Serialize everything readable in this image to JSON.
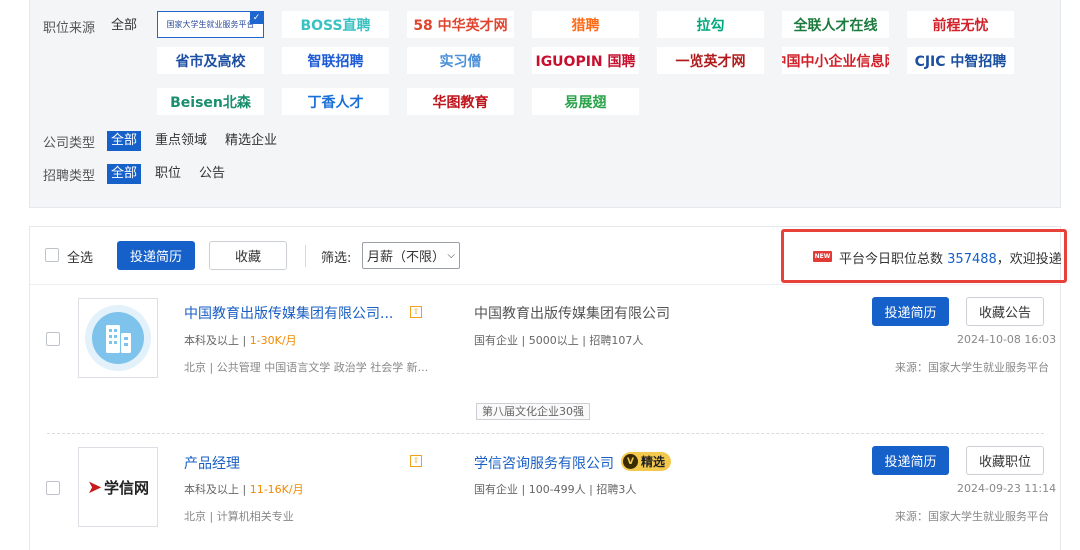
{
  "filters": {
    "source": {
      "label": "职位来源",
      "all": "全部",
      "logos": [
        {
          "name": "ncss",
          "text": "国家大学生就业服务平台",
          "color": "#2a4a9a"
        },
        {
          "name": "boss",
          "text": "BOSS直聘",
          "color": "#3ac2c2"
        },
        {
          "name": "58",
          "text": "58 中华英才网",
          "color": "#e0442f"
        },
        {
          "name": "liepin",
          "text": "猎聘",
          "color": "#ff6a16"
        },
        {
          "name": "lagou",
          "text": "拉勾",
          "color": "#00a87e"
        },
        {
          "name": "quanlian",
          "text": "全联人才在线",
          "color": "#1c7a3e"
        },
        {
          "name": "51job",
          "text": "前程无忧",
          "color": "#d1212a"
        },
        {
          "name": "provincial",
          "text": "省市及高校",
          "color": "#1d4ea3"
        },
        {
          "name": "zhilian",
          "text": "智联招聘",
          "color": "#1e5bd6"
        },
        {
          "name": "shixiseng",
          "text": "实习僧",
          "color": "#4a8fd8"
        },
        {
          "name": "iguopin",
          "text": "IGUOPIN 国聘",
          "color": "#c8102e"
        },
        {
          "name": "job5156",
          "text": "一览英才网",
          "color": "#b01a1a"
        },
        {
          "name": "sme",
          "text": "中国中小企业信息网",
          "color": "#d1212a"
        },
        {
          "name": "cjol",
          "text": "CJIC 中智招聘",
          "color": "#1b4fa0"
        },
        {
          "name": "beisen",
          "text": "Beisen北森",
          "color": "#1a8f6e"
        },
        {
          "name": "dingxiang",
          "text": "丁香人才",
          "color": "#1a70d8"
        },
        {
          "name": "huatu",
          "text": "华图教育",
          "color": "#c0141c"
        },
        {
          "name": "yizhanchi",
          "text": "易展翅",
          "color": "#2aa34a"
        }
      ]
    },
    "company_type": {
      "label": "公司类型",
      "options": [
        "全部",
        "重点领域",
        "精选企业"
      ]
    },
    "recruit_type": {
      "label": "招聘类型",
      "options": [
        "全部",
        "职位",
        "公告"
      ]
    }
  },
  "toolbar": {
    "select_all": "全选",
    "apply_label": "投递简历",
    "favorite_label": "收藏",
    "filter_label": "筛选:",
    "salary_select": "月薪（不限）",
    "new_badge": "NEW",
    "total_prefix": "平台今日职位总数",
    "total_count": "357488",
    "total_suffix": "，欢迎投递"
  },
  "jobs": [
    {
      "title": "中国教育出版传媒集团有限公司...",
      "edu": "本科及以上",
      "salary": "1-30K/月",
      "tags": "北京 | 公共管理 中国语言文学 政治学 社会学 新...",
      "company": "中国教育出版传媒集团有限公司",
      "company_meta": "国有企业 | 5000以上 | 招聘107人",
      "apply": "投递简历",
      "favorite": "收藏公告",
      "date": "2024-10-08 16:03",
      "source": "来源：国家大学生就业服务平台",
      "badge": "第八届文化企业30强"
    },
    {
      "title": "产品经理",
      "edu": "本科及以上",
      "salary": "11-16K/月",
      "tags": "北京 | 计算机相关专业",
      "company": "学信咨询服务有限公司",
      "company_badge": "精选",
      "company_meta": "国有企业 | 100-499人 | 招聘3人",
      "apply": "投递简历",
      "favorite": "收藏职位",
      "date": "2024-09-23 11:14",
      "source": "来源：国家大学生就业服务平台",
      "logo_text": "学信网"
    }
  ]
}
